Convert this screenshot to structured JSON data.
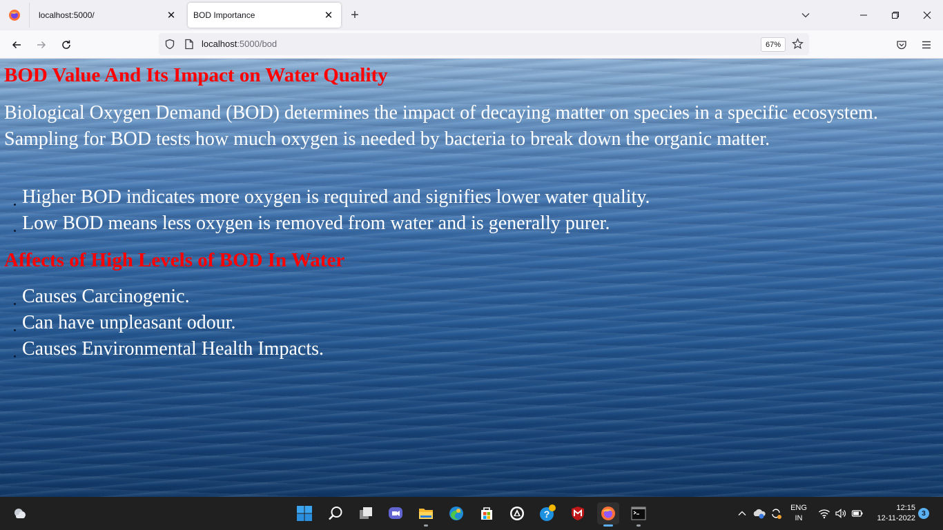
{
  "browser": {
    "tabs": [
      {
        "label": "localhost:5000/"
      },
      {
        "label": "BOD Importance"
      }
    ],
    "url_host": "localhost",
    "url_path": ":5000/bod",
    "zoom": "67%"
  },
  "page": {
    "title": "BOD Value And Its Impact on Water Quality",
    "paragraph1": "Biological Oxygen Demand (BOD) determines the impact of decaying matter on species in a specific ecosystem.",
    "paragraph2": "Sampling for BOD tests how much oxygen is needed by bacteria to break down the organic matter.",
    "bullets1": [
      "Higher BOD indicates more oxygen is required and signifies lower water quality.",
      "Low BOD means less oxygen is removed from water and is generally purer."
    ],
    "subtitle": "Affects of High Levels of BOD In Water",
    "bullets2": [
      "Causes Carcinogenic.",
      "Can have unpleasant odour.",
      "Causes Environmental Health Impacts."
    ]
  },
  "taskbar": {
    "language_line1": "ENG",
    "language_line2": "IN",
    "time": "12:15",
    "date": "12-11-2022",
    "notification_count": "3"
  },
  "colors": {
    "heading": "#ff0000",
    "body_text": "#ffffff",
    "taskbar_bg": "#202020"
  },
  "icons": [
    "firefox-icon",
    "close-icon",
    "plus-icon",
    "chevron-down-icon",
    "minimize-icon",
    "restore-icon",
    "back-icon",
    "forward-icon",
    "reload-icon",
    "shield-icon",
    "page-icon",
    "star-icon",
    "pocket-icon",
    "menu-icon",
    "weather-icon",
    "windows-start-icon",
    "search-icon",
    "task-view-icon",
    "teams-chat-icon",
    "file-explorer-icon",
    "edge-icon",
    "store-icon",
    "app-icon",
    "help-icon",
    "mcafee-icon",
    "terminal-icon",
    "tray-chevron-icon",
    "onedrive-icon",
    "sync-icon",
    "wifi-icon",
    "volume-icon",
    "battery-icon"
  ]
}
